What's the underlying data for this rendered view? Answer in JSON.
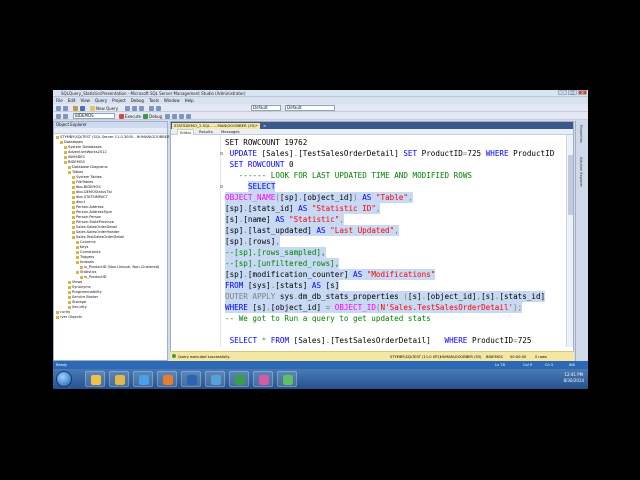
{
  "window": {
    "title": "SQLQuery_StatisticsPresentation - Microsoft SQL Server Management Studio (Administrator)",
    "buttons": [
      "–",
      "□",
      "×"
    ]
  },
  "menu": [
    "File",
    "Edit",
    "View",
    "Query",
    "Project",
    "Debug",
    "Tools",
    "Window",
    "Help"
  ],
  "toolbar": {
    "new_query": "New Query",
    "database": "BIDEMOS",
    "execute": "Execute",
    "debug": "Debug",
    "combo1": "Default",
    "combo2": "Default"
  },
  "object_explorer": {
    "header": "Object Explorer",
    "nodes": [
      {
        "label": "STYMBY\\SQLTEST (SQL Server 11.0.3000 - HUMAN\\GOOBBER)",
        "indent": 0
      },
      {
        "label": "Databases",
        "indent": 1
      },
      {
        "label": "System Databases",
        "indent": 2
      },
      {
        "label": "AdventureWorks2012",
        "indent": 2
      },
      {
        "label": "AWHIDEC",
        "indent": 2
      },
      {
        "label": "BIDEMOS",
        "indent": 2
      },
      {
        "label": "Database Diagrams",
        "indent": 3
      },
      {
        "label": "Tables",
        "indent": 3
      },
      {
        "label": "System Tables",
        "indent": 4
      },
      {
        "label": "FileTables",
        "indent": 4
      },
      {
        "label": "dbo.BIDEMOS",
        "indent": 4
      },
      {
        "label": "dbo.DEMOStatusTbl",
        "indent": 4
      },
      {
        "label": "dbo.STATSIMPACT",
        "indent": 4
      },
      {
        "label": "dbo.t",
        "indent": 4
      },
      {
        "label": "Person.Address",
        "indent": 4
      },
      {
        "label": "Person.AddressType",
        "indent": 4
      },
      {
        "label": "Person.Person",
        "indent": 4
      },
      {
        "label": "Person.StateProvince",
        "indent": 4
      },
      {
        "label": "Sales.SalesOrderDetail",
        "indent": 4
      },
      {
        "label": "Sales.SalesOrderHeader",
        "indent": 4
      },
      {
        "label": "Sales.TestSalesOrderDetail",
        "indent": 4
      },
      {
        "label": "Columns",
        "indent": 5
      },
      {
        "label": "Keys",
        "indent": 5
      },
      {
        "label": "Constraints",
        "indent": 5
      },
      {
        "label": "Triggers",
        "indent": 5
      },
      {
        "label": "Indexes",
        "indent": 5
      },
      {
        "label": "ix_ProductID (Non-Unique, Non-Clustered)",
        "indent": 6
      },
      {
        "label": "Statistics",
        "indent": 5
      },
      {
        "label": "ix_ProductID",
        "indent": 6
      },
      {
        "label": "Views",
        "indent": 3
      },
      {
        "label": "Synonyms",
        "indent": 3
      },
      {
        "label": "Programmability",
        "indent": 3
      },
      {
        "label": "Service Broker",
        "indent": 3
      },
      {
        "label": "Storage",
        "indent": 3
      },
      {
        "label": "Security",
        "indent": 3
      },
      {
        "label": "curity",
        "indent": 0
      },
      {
        "label": "rver Objects",
        "indent": 0
      }
    ]
  },
  "editor": {
    "tabs": [
      "STATSDEMO_2.SQL - ...MAN\\GOOBBER (55)*",
      "×"
    ],
    "subtabs": [
      "Editor",
      "Results",
      "Messages"
    ],
    "zoom": "100 %",
    "query_status": "Query executed successfully.",
    "lines": [
      {
        "indent": 0,
        "hl": false,
        "parts": [
          [
            "tx",
            "SET ROWCOUNT 19762"
          ]
        ]
      },
      {
        "indent": 1,
        "hl": false,
        "parts": [
          [
            "kw",
            "UPDATE "
          ],
          [
            "tx",
            "[Sales]"
          ],
          [
            "gr",
            "."
          ],
          [
            "tx",
            "[TestSalesOrderDetail] "
          ],
          [
            "kw",
            "SET "
          ],
          [
            "tx",
            "ProductID"
          ],
          [
            "gr",
            "="
          ],
          [
            "tx",
            "725 "
          ],
          [
            "kw",
            "WHERE "
          ],
          [
            "tx",
            "ProductID"
          ]
        ]
      },
      {
        "indent": 1,
        "hl": false,
        "parts": [
          [
            "kw",
            "SET ROWCOUNT "
          ],
          [
            "tx",
            "0"
          ]
        ]
      },
      {
        "indent": 3,
        "hl": false,
        "parts": [
          [
            "cm",
            "------ LOOK FOR LAST UPDATED TIME AND MODIFIED ROWS"
          ]
        ]
      },
      {
        "indent": 5,
        "hl": true,
        "parts": [
          [
            "kw",
            "SELECT"
          ]
        ]
      },
      {
        "indent": 0,
        "hl": true,
        "parts": [
          [
            "fn",
            "OBJECT_NAME"
          ],
          [
            "gr",
            "("
          ],
          [
            "tx",
            "[sp]"
          ],
          [
            "gr",
            "."
          ],
          [
            "tx",
            "[object_id]"
          ],
          [
            "gr",
            ") "
          ],
          [
            "kw",
            "AS "
          ],
          [
            "str",
            "\"Table\""
          ],
          [
            "gr",
            ","
          ]
        ]
      },
      {
        "indent": 0,
        "hl": true,
        "parts": [
          [
            "tx",
            "[sp]"
          ],
          [
            "gr",
            "."
          ],
          [
            "tx",
            "[stats_id] "
          ],
          [
            "kw",
            "AS "
          ],
          [
            "str",
            "\"Statistic ID\""
          ],
          [
            "gr",
            ","
          ]
        ]
      },
      {
        "indent": 0,
        "hl": true,
        "parts": [
          [
            "tx",
            "[s]"
          ],
          [
            "gr",
            "."
          ],
          [
            "tx",
            "[name] "
          ],
          [
            "kw",
            "AS "
          ],
          [
            "str",
            "\"Statistic\""
          ],
          [
            "gr",
            ","
          ]
        ]
      },
      {
        "indent": 0,
        "hl": true,
        "parts": [
          [
            "tx",
            "[sp]"
          ],
          [
            "gr",
            "."
          ],
          [
            "tx",
            "[last_updated] "
          ],
          [
            "kw",
            "AS "
          ],
          [
            "str",
            "\"Last Updated\""
          ],
          [
            "gr",
            ","
          ]
        ]
      },
      {
        "indent": 0,
        "hl": true,
        "parts": [
          [
            "tx",
            "[sp]"
          ],
          [
            "gr",
            "."
          ],
          [
            "tx",
            "[rows]"
          ],
          [
            "gr",
            ","
          ]
        ]
      },
      {
        "indent": 0,
        "hl": true,
        "parts": [
          [
            "cm",
            "--[sp].[rows_sampled],"
          ]
        ]
      },
      {
        "indent": 0,
        "hl": true,
        "parts": [
          [
            "cm",
            "--[sp].[unfiltered_rows],"
          ]
        ]
      },
      {
        "indent": 0,
        "hl": true,
        "parts": [
          [
            "tx",
            "[sp]"
          ],
          [
            "gr",
            "."
          ],
          [
            "tx",
            "[modification_counter] "
          ],
          [
            "kw",
            "AS "
          ],
          [
            "str",
            "\"Modifications\""
          ]
        ]
      },
      {
        "indent": 0,
        "hl": true,
        "parts": [
          [
            "kw",
            "FROM "
          ],
          [
            "tx",
            "[sys]"
          ],
          [
            "gr",
            "."
          ],
          [
            "tx",
            "[stats] "
          ],
          [
            "kw",
            "AS "
          ],
          [
            "tx",
            "[s]"
          ]
        ]
      },
      {
        "indent": 0,
        "hl": true,
        "parts": [
          [
            "gr",
            "OUTER APPLY "
          ],
          [
            "tx",
            "sys"
          ],
          [
            "gr",
            "."
          ],
          [
            "tx",
            "dm_db_stats_properties "
          ],
          [
            "gr",
            "("
          ],
          [
            "tx",
            "[s]"
          ],
          [
            "gr",
            "."
          ],
          [
            "tx",
            "[object_id]"
          ],
          [
            "gr",
            ","
          ],
          [
            "tx",
            "[s]"
          ],
          [
            "gr",
            "."
          ],
          [
            "tx",
            "[stats_id]"
          ]
        ]
      },
      {
        "indent": 0,
        "hl": true,
        "parts": [
          [
            "kw",
            "WHERE "
          ],
          [
            "tx",
            "[s]"
          ],
          [
            "gr",
            "."
          ],
          [
            "tx",
            "[object_id] "
          ],
          [
            "gr",
            "= "
          ],
          [
            "fn",
            "OBJECT_ID"
          ],
          [
            "gr",
            "("
          ],
          [
            "str",
            "N'Sales.TestSalesOrderDetail'"
          ],
          [
            "gr",
            ");"
          ]
        ]
      },
      {
        "indent": 0,
        "hl": false,
        "parts": [
          [
            "cm",
            "-- We got to Run a query to get updated stats"
          ]
        ]
      },
      {
        "indent": 0,
        "hl": false,
        "parts": [
          [
            "tx",
            ""
          ]
        ]
      },
      {
        "indent": 1,
        "hl": false,
        "parts": [
          [
            "kw",
            "SELECT "
          ],
          [
            "gr",
            "* "
          ],
          [
            "kw",
            "FROM "
          ],
          [
            "tx",
            "[Sales]"
          ],
          [
            "gr",
            "."
          ],
          [
            "tx",
            "[TestSalesOrderDetail]   "
          ],
          [
            "kw",
            "WHERE "
          ],
          [
            "tx",
            "ProductID"
          ],
          [
            "gr",
            "="
          ],
          [
            "tx",
            "725"
          ]
        ]
      }
    ]
  },
  "statusbar": {
    "left": "Ready",
    "server": "STYMBY\\SQLTEST (11.0 SP1)",
    "user": "HUMAN\\GOOBBER (55)",
    "db": "BIDEMOS",
    "time": "00:00:00",
    "rows": "0 rows",
    "ln": "Ln 78",
    "col": "Col 9",
    "ch": "Ch 5",
    "ins": "INS"
  },
  "properties_labels": [
    "Properties",
    "Solution Explorer"
  ],
  "taskbar": {
    "time": "12:41 PM",
    "date": "8/30/2014",
    "buttons": [
      "explorer",
      "folder",
      "ie",
      "media",
      "ssms",
      "calc",
      "excel",
      "paint",
      "chat"
    ],
    "button_colors": [
      "#f0c24a",
      "#e1b64a",
      "#4aa0e8",
      "#e87b2c",
      "#2b63b0",
      "#5aa0d8",
      "#3b9c4a",
      "#d65aa0",
      "#60c060"
    ]
  }
}
